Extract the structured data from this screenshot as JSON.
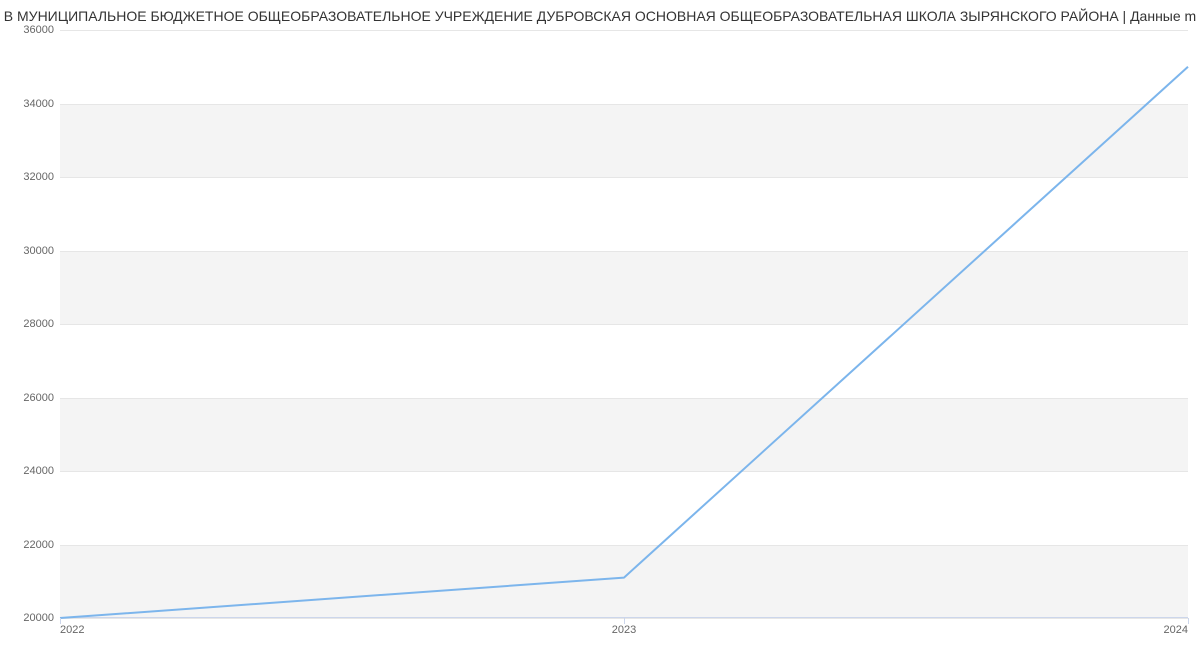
{
  "chart_data": {
    "type": "line",
    "title": "В МУНИЦИПАЛЬНОЕ БЮДЖЕТНОЕ ОБЩЕОБРАЗОВАТЕЛЬНОЕ УЧРЕЖДЕНИЕ ДУБРОВСКАЯ ОСНОВНАЯ ОБЩЕОБРАЗОВАТЕЛЬНАЯ ШКОЛА ЗЫРЯНСКОГО РАЙОНА | Данные m",
    "categories": [
      "2022",
      "2023",
      "2024"
    ],
    "values": [
      20000,
      21100,
      35000
    ],
    "y_ticks": [
      20000,
      22000,
      24000,
      26000,
      28000,
      30000,
      32000,
      34000,
      36000
    ],
    "ylim": [
      20000,
      36000
    ],
    "xlabel": "",
    "ylabel": "",
    "colors": {
      "line": "#7cb5ec",
      "band": "#f4f4f4"
    }
  }
}
